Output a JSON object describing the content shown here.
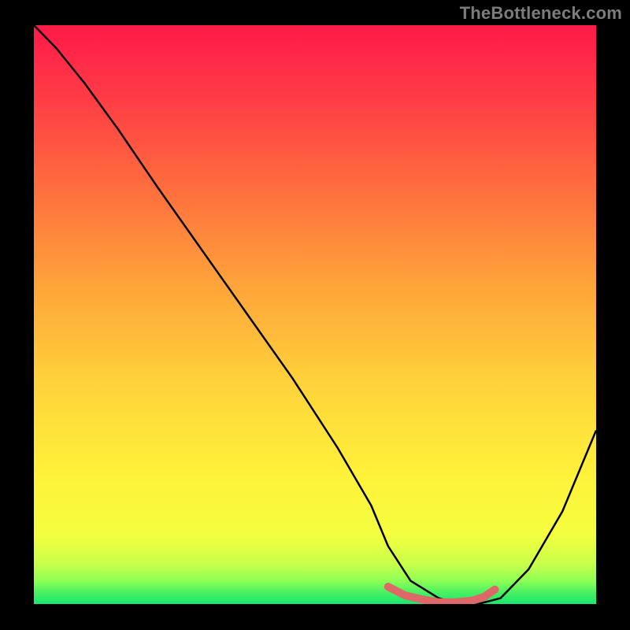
{
  "watermark": "TheBottleneck.com",
  "chart_data": {
    "type": "line",
    "title": "",
    "xlabel": "",
    "ylabel": "",
    "xlim": [
      0,
      100
    ],
    "ylim": [
      0,
      100
    ],
    "grid": false,
    "background_gradient": {
      "top": "#ff1a49",
      "mid_upper": "#ff6d3e",
      "mid": "#ffd33a",
      "mid_lower": "#fff23a",
      "bottom": "#17e86f"
    },
    "series": [
      {
        "name": "bottleneck-curve",
        "color": "#000000",
        "x": [
          0,
          4,
          9,
          15,
          22,
          30,
          38,
          46,
          54,
          60,
          63,
          67,
          72,
          76,
          79,
          83,
          88,
          94,
          100
        ],
        "y": [
          100,
          96,
          90,
          82,
          72,
          61,
          50,
          39,
          27,
          17,
          10,
          4,
          1,
          0,
          0,
          1,
          6,
          16,
          30
        ]
      },
      {
        "name": "trough-highlight",
        "color": "#de6868",
        "thick": true,
        "x": [
          63,
          66,
          69,
          72,
          75,
          78,
          80,
          82
        ],
        "y": [
          3,
          1.5,
          0.8,
          0.3,
          0.3,
          0.6,
          1.2,
          2.5
        ]
      }
    ]
  }
}
